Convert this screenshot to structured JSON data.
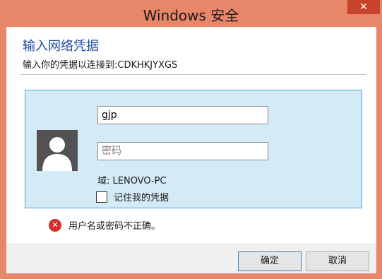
{
  "window": {
    "title": "Windows 安全",
    "close_glyph": "✕"
  },
  "dialog": {
    "heading": "输入网络凭据",
    "subheading": "输入你的凭据以连接到:CDKHKJYXGS"
  },
  "credentials": {
    "username_value": "gjp",
    "password_placeholder": "密码",
    "domain_text": "域: LENOVO-PC",
    "remember_label": "记住我的凭据",
    "remember_checked": false
  },
  "error": {
    "icon": "error-x-icon",
    "glyph": "✕",
    "message": "用户名或密码不正确。"
  },
  "buttons": {
    "ok_label": "确定",
    "cancel_label": "取消"
  },
  "colors": {
    "frame": "#e8866a",
    "close_button": "#c7442b",
    "heading": "#1e4aa0",
    "tile_background": "#d4eaf6",
    "tile_border": "#4aa3d8",
    "error_icon": "#d0312d"
  }
}
